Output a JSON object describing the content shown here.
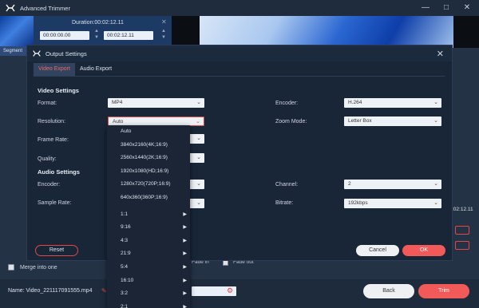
{
  "app": {
    "title": "Advanced Trimmer",
    "window_controls": [
      "minimize",
      "maximize",
      "close"
    ]
  },
  "trim": {
    "duration": "Duration:00:02:12.11",
    "start": "00:00:00.00",
    "end": "00:02:12.11",
    "segment_label": "Segment"
  },
  "background": {
    "right_time": ":02:12.11",
    "merge_label": "Merge into one",
    "fade_in": "Fade in",
    "fade_out": "Fade out",
    "name_label": "Name:  Video_221117091555.mp4",
    "back_label": "Back",
    "trim_label": "Trim"
  },
  "dialog": {
    "title": "Output Settings",
    "tabs": [
      {
        "label": "Video Export",
        "active": true
      },
      {
        "label": "Audio Export",
        "active": false
      }
    ],
    "video_section": "Video Settings",
    "audio_section": "Audio Settings",
    "fields": {
      "format": {
        "label": "Format:",
        "value": "MP4"
      },
      "resolution": {
        "label": "Resolution:",
        "value": "Auto"
      },
      "frame_rate": {
        "label": "Frame Rate:",
        "value": ""
      },
      "quality": {
        "label": "Quality:",
        "value": ""
      },
      "video_encoder": {
        "label": "Encoder:",
        "value": "H.264"
      },
      "zoom_mode": {
        "label": "Zoom Mode:",
        "value": "Letter Box"
      },
      "audio_encoder": {
        "label": "Encoder:",
        "value": ""
      },
      "sample_rate": {
        "label": "Sample Rate:",
        "value": ""
      },
      "channel": {
        "label": "Channel:",
        "value": "2"
      },
      "bitrate": {
        "label": "Bitrate:",
        "value": "192kbps"
      }
    },
    "reset_label": "Reset",
    "cancel_label": "Cancel",
    "ok_label": "OK"
  },
  "resolution_dropdown": {
    "options": [
      {
        "label": "Auto",
        "submenu": false
      },
      {
        "label": "3840x2160(4K;16:9)",
        "submenu": false
      },
      {
        "label": "2560x1440(2K;16:9)",
        "submenu": false
      },
      {
        "label": "1920x1080(HD;16:9)",
        "submenu": false
      },
      {
        "label": "1280x720(720P;16:9)",
        "submenu": false
      },
      {
        "label": "640x360(360P;16:9)",
        "submenu": false
      },
      {
        "label": "",
        "submenu": false
      },
      {
        "label": "1:1",
        "submenu": true
      },
      {
        "label": "9:16",
        "submenu": true
      },
      {
        "label": "4:3",
        "submenu": true
      },
      {
        "label": "21:9",
        "submenu": true
      },
      {
        "label": "5:4",
        "submenu": true
      },
      {
        "label": "16:10",
        "submenu": true
      },
      {
        "label": "3:2",
        "submenu": true
      },
      {
        "label": "2:1",
        "submenu": true
      }
    ]
  },
  "colors": {
    "accent": "#f25a5a",
    "dialog_bg": "#182638",
    "app_bg": "#243245"
  }
}
